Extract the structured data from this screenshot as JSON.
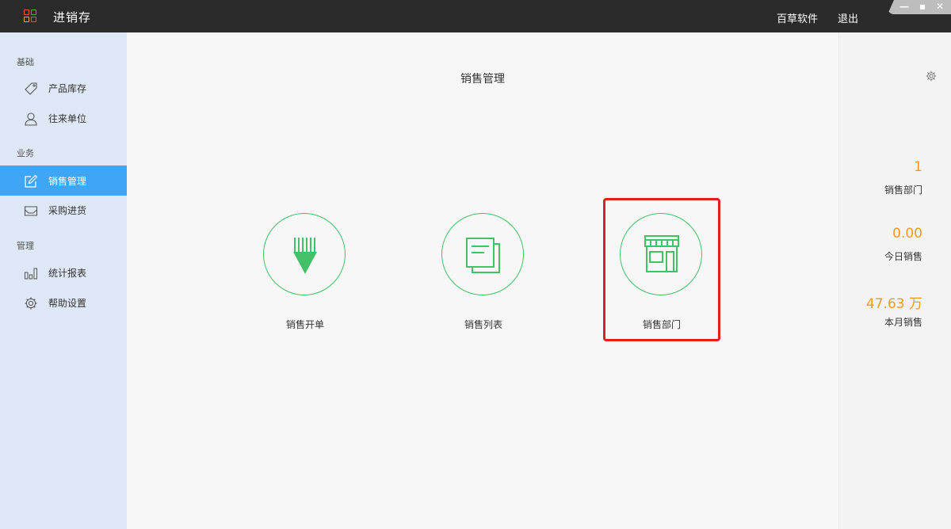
{
  "app": {
    "title": "进销存"
  },
  "header": {
    "links": [
      "百草软件",
      "退出"
    ]
  },
  "window_controls": {
    "minimize": "—",
    "maximize": "▪",
    "close": "✕"
  },
  "sidebar": {
    "sections": [
      {
        "label": "基础",
        "items": [
          {
            "label": "产品库存",
            "icon": "tag-icon"
          },
          {
            "label": "往来单位",
            "icon": "user-icon"
          }
        ]
      },
      {
        "label": "业务",
        "items": [
          {
            "label": "销售管理",
            "icon": "edit-icon",
            "active": true
          },
          {
            "label": "采购进货",
            "icon": "inbox-icon"
          }
        ]
      },
      {
        "label": "管理",
        "items": [
          {
            "label": "统计报表",
            "icon": "bar-chart-icon"
          },
          {
            "label": "帮助设置",
            "icon": "gear-icon"
          }
        ]
      }
    ]
  },
  "main": {
    "title": "销售管理",
    "actions": [
      {
        "label": "销售开单",
        "icon": "pencil-icon"
      },
      {
        "label": "销售列表",
        "icon": "documents-icon"
      },
      {
        "label": "销售部门",
        "icon": "storefront-icon",
        "highlighted": true
      }
    ]
  },
  "stats": [
    {
      "value": "1",
      "label": "销售部门"
    },
    {
      "value": "0.00",
      "label": "今日销售"
    },
    {
      "value": "47.63 万",
      "label": "本月销售"
    }
  ],
  "colors": {
    "accent_blue": "#3fa6f7",
    "green": "#43c068",
    "orange": "#f39a1e",
    "highlight_red": "#e02020",
    "titlebar": "#2b2b2b",
    "sidebar_bg": "#dde7f5"
  }
}
